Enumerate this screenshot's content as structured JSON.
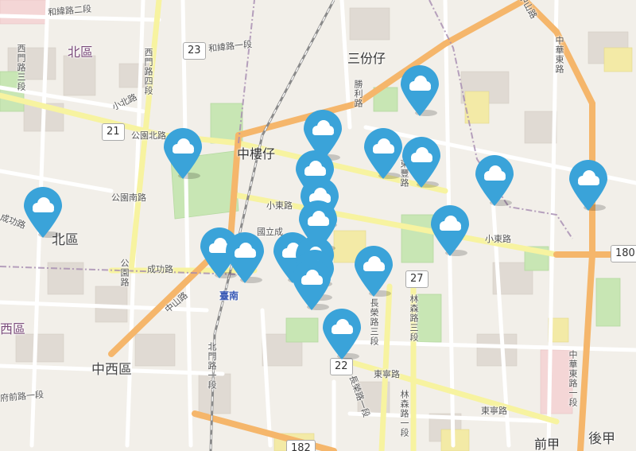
{
  "map": {
    "districts": [
      {
        "id": "bei-1",
        "text": "北區",
        "style": "district"
      },
      {
        "id": "bei-2",
        "text": "北區",
        "style": "district big"
      },
      {
        "id": "xi",
        "text": "西區",
        "style": "district"
      },
      {
        "id": "zhongxi",
        "text": "中西區",
        "style": "district big"
      },
      {
        "id": "houjia",
        "text": "後甲",
        "style": "district big"
      }
    ],
    "places": [
      {
        "id": "sanfenzi",
        "text": "三份仔"
      },
      {
        "id": "zhonglouzai",
        "text": "中樓仔"
      },
      {
        "id": "qianjia",
        "text": "前甲"
      }
    ],
    "roads": [
      "和緯路二段",
      "和緯路一段",
      "西門路四段",
      "西門路三段",
      "小北路",
      "公園北路",
      "公園南路",
      "成功路",
      "成功路",
      "公園路",
      "中山路",
      "中山路",
      "北門路一段",
      "小東路",
      "小東路",
      "東寧路",
      "東寧路",
      "長榮路三段",
      "林森路三段",
      "長榮路一段",
      "林森路一段",
      "東豐路",
      "中華東路一段",
      "中華東路",
      "府前路一段",
      "勝利路",
      "國立成"
    ],
    "station": "臺南",
    "shields": [
      "23",
      "21",
      "27",
      "22",
      "180",
      "182"
    ]
  },
  "markers": [
    {
      "id": 1,
      "icon": "weather-cloud-icon",
      "lon_lat": [
        0.067,
        0.46
      ]
    },
    {
      "id": 2,
      "icon": "weather-cloud-icon",
      "lon_lat": [
        0.287,
        0.33
      ]
    },
    {
      "id": 3,
      "icon": "weather-cloud-icon",
      "lon_lat": [
        0.508,
        0.29
      ]
    },
    {
      "id": 4,
      "icon": "weather-cloud-icon",
      "lon_lat": [
        0.495,
        0.38
      ]
    },
    {
      "id": 5,
      "icon": "weather-cloud-icon",
      "lon_lat": [
        0.503,
        0.44
      ]
    },
    {
      "id": 6,
      "icon": "weather-cloud-icon",
      "lon_lat": [
        0.5,
        0.49
      ]
    },
    {
      "id": 7,
      "icon": "weather-cloud-icon",
      "lon_lat": [
        0.345,
        0.55
      ]
    },
    {
      "id": 8,
      "icon": "weather-cloud-icon",
      "lon_lat": [
        0.385,
        0.56
      ]
    },
    {
      "id": 9,
      "icon": "weather-cloud-icon",
      "lon_lat": [
        0.46,
        0.56
      ]
    },
    {
      "id": 10,
      "icon": "weather-cloud-icon",
      "lon_lat": [
        0.495,
        0.57
      ]
    },
    {
      "id": 11,
      "icon": "weather-cloud-icon",
      "lon_lat": [
        0.495,
        0.6
      ]
    },
    {
      "id": 12,
      "icon": "weather-cloud-icon",
      "lon_lat": [
        0.49,
        0.62
      ]
    },
    {
      "id": 13,
      "icon": "weather-cloud-icon",
      "lon_lat": [
        0.537,
        0.73
      ]
    },
    {
      "id": 14,
      "icon": "weather-cloud-icon",
      "lon_lat": [
        0.588,
        0.59
      ]
    },
    {
      "id": 15,
      "icon": "weather-cloud-icon",
      "lon_lat": [
        0.603,
        0.33
      ]
    },
    {
      "id": 16,
      "icon": "weather-cloud-icon",
      "lon_lat": [
        0.663,
        0.35
      ]
    },
    {
      "id": 17,
      "icon": "weather-cloud-icon",
      "lon_lat": [
        0.66,
        0.19
      ]
    },
    {
      "id": 18,
      "icon": "weather-cloud-icon",
      "lon_lat": [
        0.708,
        0.5
      ]
    },
    {
      "id": 19,
      "icon": "weather-cloud-icon",
      "lon_lat": [
        0.778,
        0.39
      ]
    },
    {
      "id": 20,
      "icon": "weather-cloud-icon",
      "lon_lat": [
        0.925,
        0.4
      ]
    }
  ],
  "colors": {
    "marker": "#3aa3d9",
    "marker_cloud": "#ffffff",
    "major_road": "#f5b66b",
    "secondary_road": "#f7f3a0",
    "park": "#c8e6b4",
    "rail": "#888888",
    "boundary": "#a58bb0"
  }
}
